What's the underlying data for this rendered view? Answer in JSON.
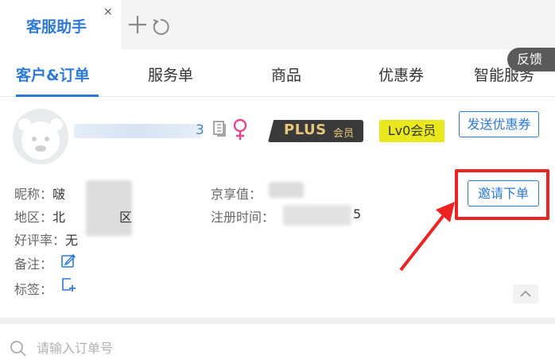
{
  "window_tabs": {
    "active_title": "客服助手",
    "close_glyph": "×"
  },
  "nav": {
    "tabs": [
      "客户&订单",
      "服务单",
      "商品",
      "优惠券",
      "智能服务"
    ],
    "feedback_label": "反馈"
  },
  "customer": {
    "name_tail": "3",
    "plus_badge": {
      "main": "PLUS",
      "sub": "会员"
    },
    "level_badge": "Lv0会员",
    "send_coupon_label": "发送优惠券",
    "invite_order_label": "邀请下单",
    "fields": {
      "nickname_label": "昵称：",
      "nickname_value": "啵",
      "region_label": "地区：",
      "region_prefix": "北",
      "region_suffix": "区",
      "rating_label": "好评率：",
      "rating_value": "无",
      "remark_label": "备注：",
      "tags_label": "标签：",
      "jing_value_label": "京享值：",
      "register_label": "注册时间：",
      "register_suffix": "5"
    }
  },
  "search": {
    "placeholder": "请输入订单号"
  },
  "colors": {
    "accent": "#2d7ad6",
    "highlight": "#ee2222",
    "level_badge": "#e8e81c",
    "female": "#e5458b"
  }
}
